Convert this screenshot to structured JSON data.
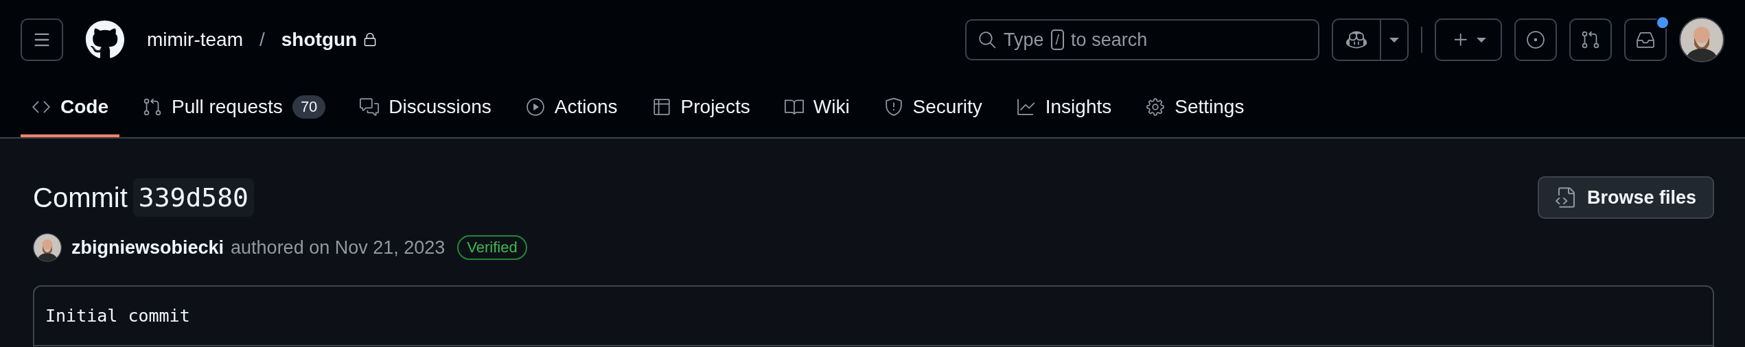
{
  "header": {
    "owner": "mimir-team",
    "separator": "/",
    "repo": "shotgun",
    "private": true,
    "search": {
      "before": "Type",
      "key": "/",
      "after": "to search"
    },
    "inbox_unread": true
  },
  "tabs": [
    {
      "label": "Code",
      "selected": true
    },
    {
      "label": "Pull requests",
      "counter": "70",
      "selected": false
    },
    {
      "label": "Discussions",
      "selected": false
    },
    {
      "label": "Actions",
      "selected": false
    },
    {
      "label": "Projects",
      "selected": false
    },
    {
      "label": "Wiki",
      "selected": false
    },
    {
      "label": "Security",
      "selected": false
    },
    {
      "label": "Insights",
      "selected": false
    },
    {
      "label": "Settings",
      "selected": false
    }
  ],
  "commit": {
    "title": "Commit",
    "sha": "339d580",
    "browse_button": "Browse files",
    "author": "zbigniewsobiecki",
    "authored": "authored on Nov 21, 2023",
    "verified": true,
    "verified_label": "Verified",
    "message": "Initial commit"
  }
}
